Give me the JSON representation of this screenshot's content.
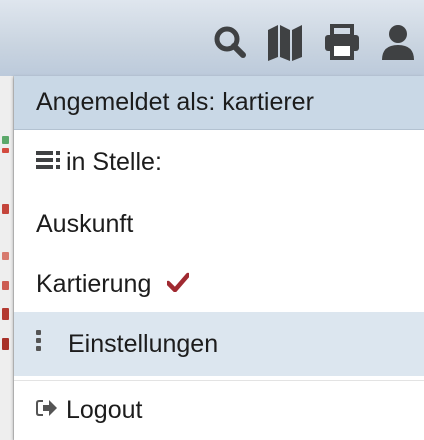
{
  "toolbar": {
    "icons": [
      "search-icon",
      "map-icon",
      "print-icon",
      "user-icon"
    ]
  },
  "menu": {
    "header_label": "Angemeldet als: kartierer",
    "stelle_label": "in Stelle:",
    "items": [
      {
        "label": "Auskunft",
        "selected": false
      },
      {
        "label": "Kartierung",
        "selected": true
      }
    ],
    "settings_label": "Einstellungen",
    "logout_label": "Logout"
  },
  "colors": {
    "toolbar_icon": "#3f4143",
    "checkmark": "#a02a31",
    "menu_header_bg": "#c9d8e6",
    "hover_row_bg": "#dce6ef"
  }
}
